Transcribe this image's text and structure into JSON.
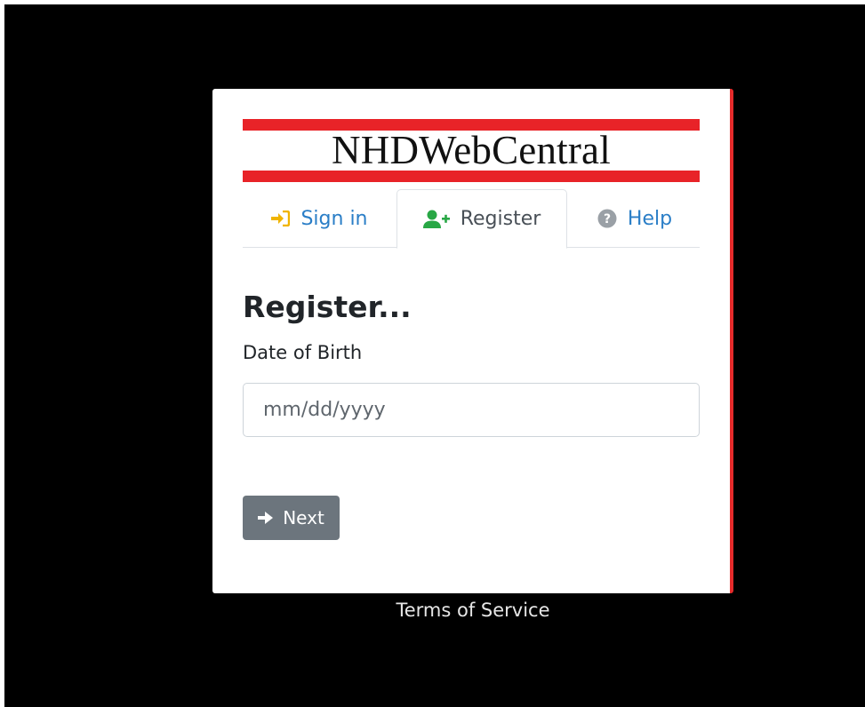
{
  "logo": {
    "text": "NHDWebCentral",
    "accent_color": "#e82328"
  },
  "tabs": [
    {
      "label": "Sign in",
      "icon": "sign-in-icon",
      "active": false,
      "color": "#2a7ec7",
      "icon_color": "#f0b400"
    },
    {
      "label": "Register",
      "icon": "user-plus-icon",
      "active": true,
      "color": "#495057",
      "icon_color": "#28a745"
    },
    {
      "label": "Help",
      "icon": "question-circle-icon",
      "active": false,
      "color": "#2a7ec7",
      "icon_color": "#9aa0a6"
    }
  ],
  "form": {
    "heading": "Register...",
    "dob_label": "Date of Birth",
    "dob_placeholder": "mm/dd/yyyy",
    "dob_value": "",
    "next_label": "Next"
  },
  "footer": {
    "terms_label": "Terms of Service"
  },
  "colors": {
    "background": "#000000",
    "card_border_accent": "#e52b2b",
    "button_bg": "#6c757d"
  }
}
